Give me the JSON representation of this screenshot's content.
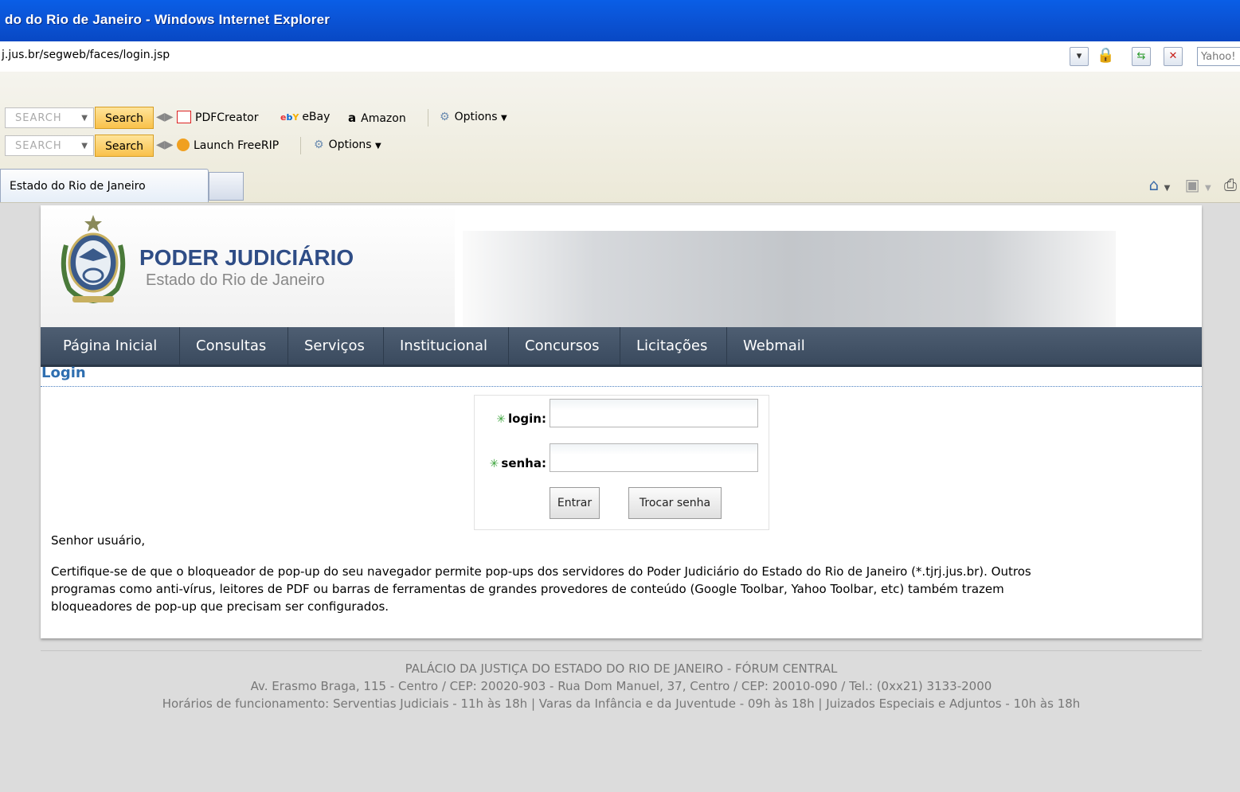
{
  "browser": {
    "window_title": "do do Rio de Janeiro - Windows Internet Explorer",
    "address": "j.jus.br/segweb/faces/login.jsp",
    "search_provider": "Yahoo!",
    "toolbar1": {
      "search_placeholder": "SEARCH",
      "search_button": "Search",
      "items": [
        "PDFCreator",
        "eBay",
        "Amazon",
        "Options"
      ]
    },
    "toolbar2": {
      "search_placeholder": "SEARCH",
      "search_button": "Search",
      "items": [
        "Launch FreeRIP",
        "Options"
      ]
    },
    "active_tab": "Estado do Rio de Janeiro"
  },
  "header": {
    "title": "PODER JUDICIÁRIO",
    "subtitle": "Estado do Rio de Janeiro"
  },
  "nav": [
    "Página Inicial",
    "Consultas",
    "Serviços",
    "Institucional",
    "Concursos",
    "Licitações",
    "Webmail"
  ],
  "login": {
    "section_title": "Login",
    "login_label": "login:",
    "password_label": "senha:",
    "login_value": "",
    "password_value": "",
    "submit_button": "Entrar",
    "change_password_button": "Trocar senha"
  },
  "notice": {
    "greeting": "Senhor usuário,",
    "line1": "Certifique-se de que o bloqueador de pop-up do seu navegador permite pop-ups dos servidores do Poder Judiciário do Estado do Rio de Janeiro (*.tjrj.jus.br). Outros",
    "line2": "programas como anti-vírus, leitores de PDF ou barras de ferramentas de grandes provedores de conteúdo (Google Toolbar, Yahoo Toolbar, etc) também trazem",
    "line3": "bloqueadores de pop-up que precisam ser configurados."
  },
  "footer": {
    "line1": "PALÁCIO DA JUSTIÇA DO ESTADO DO RIO DE JANEIRO - FÓRUM CENTRAL",
    "line2": "Av. Erasmo Braga, 115 - Centro / CEP: 20020-903 - Rua Dom Manuel, 37, Centro / CEP: 20010-090 / Tel.: (0xx21) 3133-2000",
    "line3": "Horários de funcionamento: Serventias Judiciais - 11h às 18h | Varas da Infância e da Juventude - 09h às 18h | Juizados Especiais e Adjuntos - 10h às 18h"
  },
  "colors": {
    "titlebar": "#0b55d8",
    "nav_bg": "#3a4a5e",
    "brand_blue": "#2f4d86",
    "link_blue": "#2f6fb0",
    "required_green": "#3aa33a"
  }
}
